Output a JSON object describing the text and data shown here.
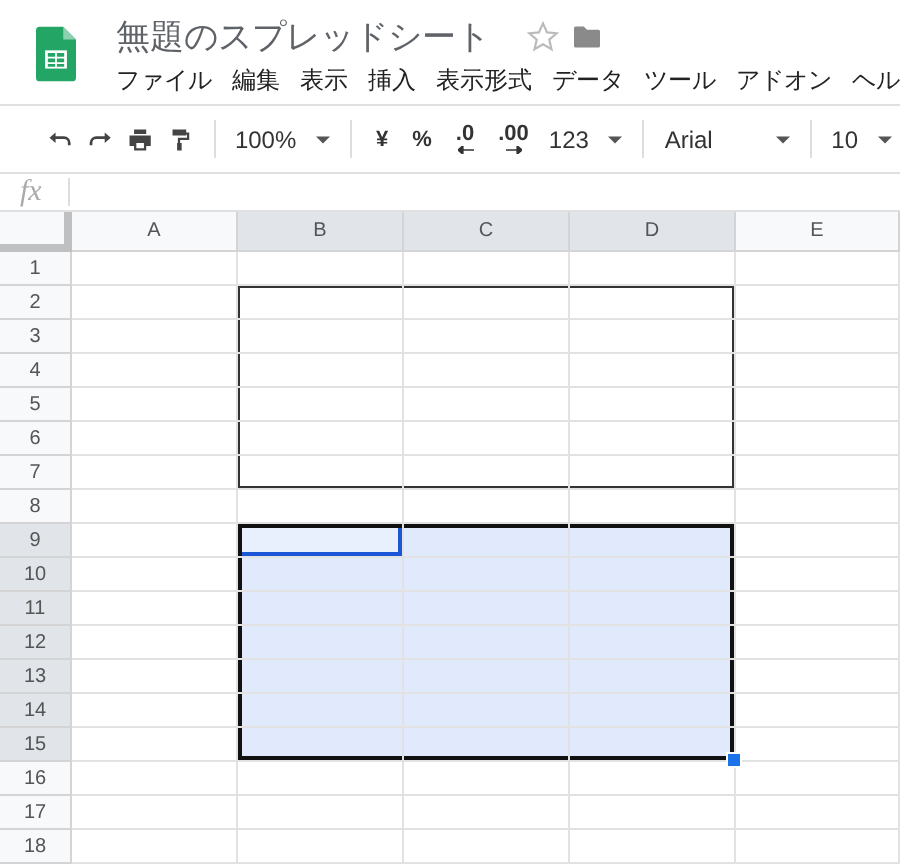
{
  "document": {
    "title": "無題のスプレッドシート",
    "starred": false
  },
  "menu": [
    "ファイル",
    "編集",
    "表示",
    "挿入",
    "表示形式",
    "データ",
    "ツール",
    "アドオン",
    "ヘル"
  ],
  "toolbar": [
    {
      "kind": "undo"
    },
    {
      "kind": "redo"
    },
    {
      "kind": "print"
    },
    {
      "kind": "paint"
    },
    {
      "kind": "separator"
    },
    {
      "kind": "dropdown",
      "label": "100%"
    },
    {
      "kind": "separator"
    },
    {
      "kind": "text",
      "label": "¥"
    },
    {
      "kind": "text",
      "label": "%"
    },
    {
      "kind": "decrease",
      "label": ".0"
    },
    {
      "kind": "increase",
      "label": ".00"
    },
    {
      "kind": "dropdown",
      "label": "123"
    },
    {
      "kind": "separator"
    },
    {
      "kind": "font",
      "label": "Arial"
    },
    {
      "kind": "separator"
    },
    {
      "kind": "dropdown",
      "label": "10"
    }
  ],
  "formula_bar": {
    "label": "fx"
  },
  "columns": [
    {
      "label": "A",
      "selected": false
    },
    {
      "label": "B",
      "selected": true
    },
    {
      "label": "C",
      "selected": true
    },
    {
      "label": "D",
      "selected": true
    },
    {
      "label": "E",
      "selected": false
    }
  ],
  "rows": [
    {
      "label": "1",
      "selected": false,
      "cells": [
        {
          "kind": "plain"
        },
        {
          "kind": "plain"
        },
        {
          "kind": "plain"
        },
        {
          "kind": "plain"
        },
        {
          "kind": "plain"
        }
      ]
    },
    {
      "label": "2",
      "selected": false,
      "cells": [
        {
          "kind": "plain"
        },
        {
          "kind": "boxed"
        },
        {
          "kind": "boxed"
        },
        {
          "kind": "boxed"
        },
        {
          "kind": "plain"
        }
      ]
    },
    {
      "label": "3",
      "selected": false,
      "cells": [
        {
          "kind": "plain"
        },
        {
          "kind": "boxed"
        },
        {
          "kind": "boxed"
        },
        {
          "kind": "boxed"
        },
        {
          "kind": "plain"
        }
      ]
    },
    {
      "label": "4",
      "selected": false,
      "cells": [
        {
          "kind": "plain"
        },
        {
          "kind": "boxed"
        },
        {
          "kind": "boxed"
        },
        {
          "kind": "boxed"
        },
        {
          "kind": "plain"
        }
      ]
    },
    {
      "label": "5",
      "selected": false,
      "cells": [
        {
          "kind": "plain"
        },
        {
          "kind": "boxed"
        },
        {
          "kind": "boxed"
        },
        {
          "kind": "boxed"
        },
        {
          "kind": "plain"
        }
      ]
    },
    {
      "label": "6",
      "selected": false,
      "cells": [
        {
          "kind": "plain"
        },
        {
          "kind": "boxed"
        },
        {
          "kind": "boxed"
        },
        {
          "kind": "boxed"
        },
        {
          "kind": "plain"
        }
      ]
    },
    {
      "label": "7",
      "selected": false,
      "cells": [
        {
          "kind": "plain"
        },
        {
          "kind": "boxed"
        },
        {
          "kind": "boxed"
        },
        {
          "kind": "boxed"
        },
        {
          "kind": "plain"
        }
      ]
    },
    {
      "label": "8",
      "selected": false,
      "cells": [
        {
          "kind": "plain"
        },
        {
          "kind": "plain"
        },
        {
          "kind": "plain"
        },
        {
          "kind": "plain"
        },
        {
          "kind": "plain"
        }
      ]
    },
    {
      "label": "9",
      "selected": true,
      "cells": [
        {
          "kind": "plain"
        },
        {
          "kind": "active"
        },
        {
          "kind": "selected"
        },
        {
          "kind": "selected"
        },
        {
          "kind": "plain"
        }
      ]
    },
    {
      "label": "10",
      "selected": true,
      "cells": [
        {
          "kind": "plain"
        },
        {
          "kind": "selected"
        },
        {
          "kind": "selected"
        },
        {
          "kind": "selected"
        },
        {
          "kind": "plain"
        }
      ]
    },
    {
      "label": "11",
      "selected": true,
      "cells": [
        {
          "kind": "plain"
        },
        {
          "kind": "selected"
        },
        {
          "kind": "selected"
        },
        {
          "kind": "selected"
        },
        {
          "kind": "plain"
        }
      ]
    },
    {
      "label": "12",
      "selected": true,
      "cells": [
        {
          "kind": "plain"
        },
        {
          "kind": "selected"
        },
        {
          "kind": "selected"
        },
        {
          "kind": "selected"
        },
        {
          "kind": "plain"
        }
      ]
    },
    {
      "label": "13",
      "selected": true,
      "cells": [
        {
          "kind": "plain"
        },
        {
          "kind": "selected"
        },
        {
          "kind": "selected"
        },
        {
          "kind": "selected"
        },
        {
          "kind": "plain"
        }
      ]
    },
    {
      "label": "14",
      "selected": true,
      "cells": [
        {
          "kind": "plain"
        },
        {
          "kind": "selected"
        },
        {
          "kind": "selected"
        },
        {
          "kind": "selected"
        },
        {
          "kind": "plain"
        }
      ]
    },
    {
      "label": "15",
      "selected": true,
      "cells": [
        {
          "kind": "plain"
        },
        {
          "kind": "selected"
        },
        {
          "kind": "selected"
        },
        {
          "kind": "selected"
        },
        {
          "kind": "plain"
        }
      ]
    },
    {
      "label": "16",
      "selected": false,
      "cells": [
        {
          "kind": "plain"
        },
        {
          "kind": "plain"
        },
        {
          "kind": "plain"
        },
        {
          "kind": "plain"
        },
        {
          "kind": "plain"
        }
      ]
    },
    {
      "label": "17",
      "selected": false,
      "cells": [
        {
          "kind": "plain"
        },
        {
          "kind": "plain"
        },
        {
          "kind": "plain"
        },
        {
          "kind": "plain"
        },
        {
          "kind": "plain"
        }
      ]
    },
    {
      "label": "18",
      "selected": false,
      "cells": [
        {
          "kind": "plain"
        },
        {
          "kind": "plain"
        },
        {
          "kind": "plain"
        },
        {
          "kind": "plain"
        },
        {
          "kind": "plain"
        }
      ]
    }
  ]
}
